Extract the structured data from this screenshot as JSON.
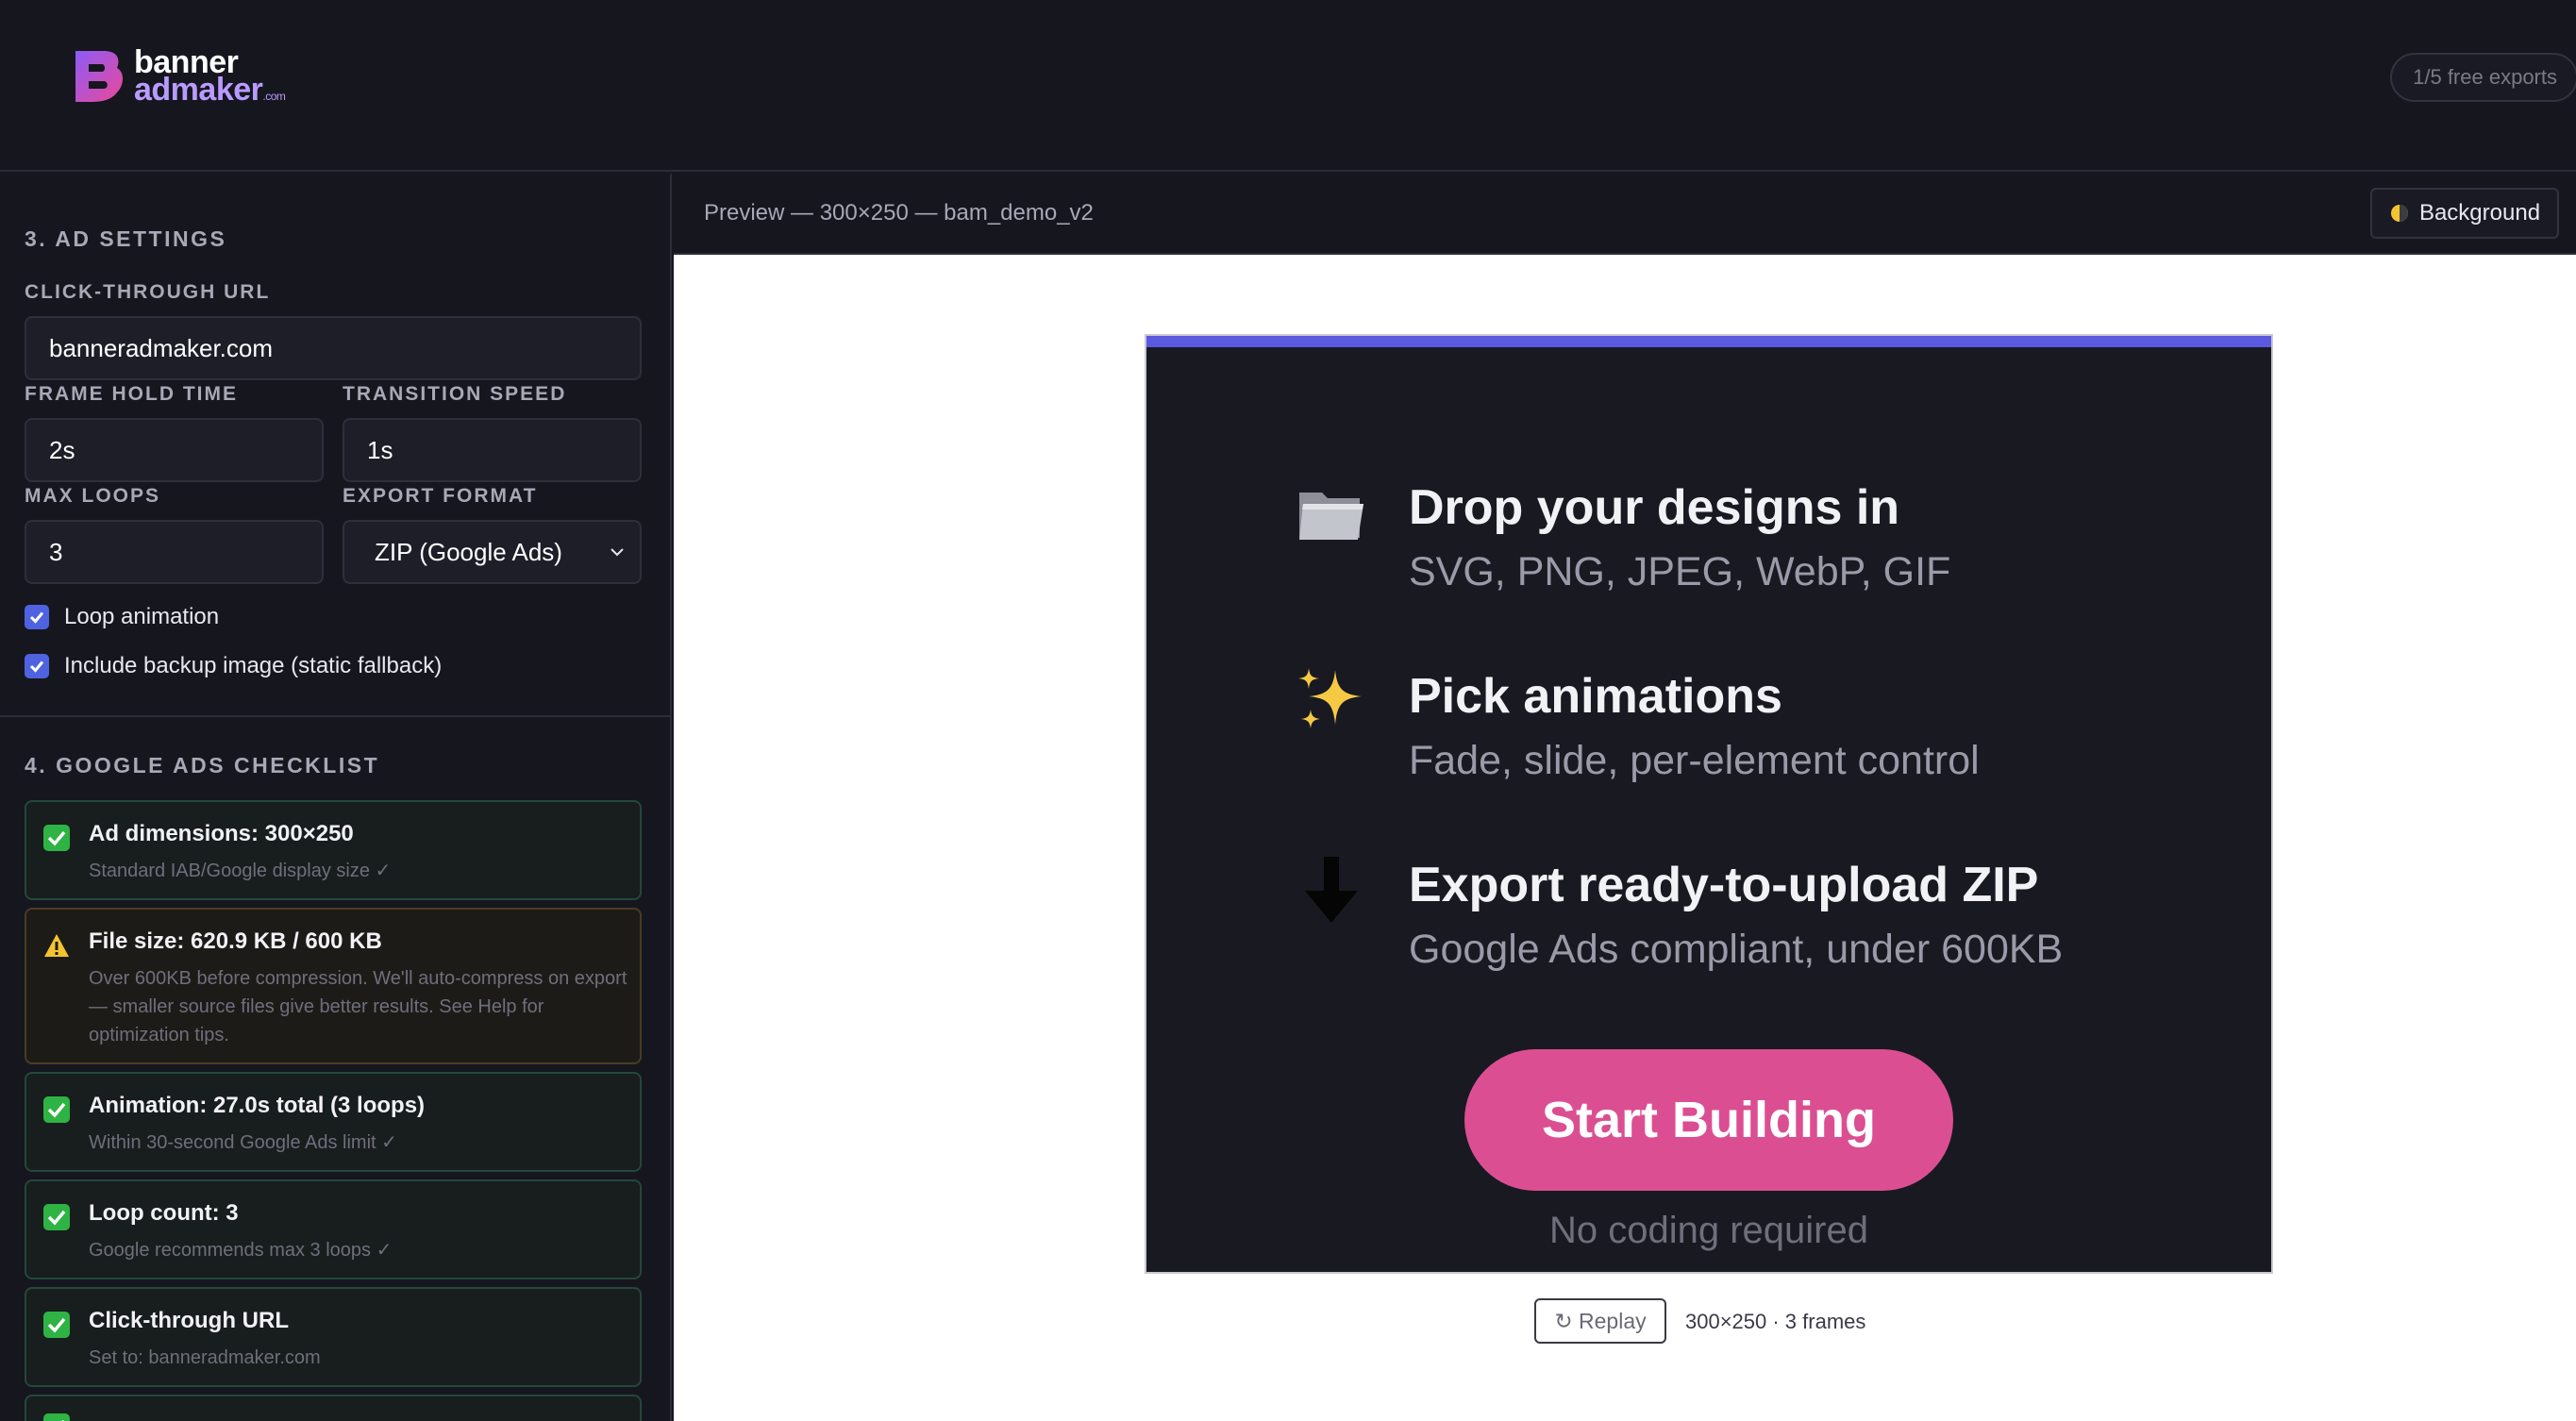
{
  "header": {
    "logo_line1": "banner",
    "logo_line2": "admaker",
    "logo_dotcom": ".com",
    "exports_label": "1/5 free exports"
  },
  "ad_settings": {
    "section_title": "3. AD SETTINGS",
    "click_url_label": "CLICK-THROUGH URL",
    "click_url_value": "banneradmaker.com",
    "frame_hold_label": "FRAME HOLD TIME",
    "frame_hold_value": "2s",
    "transition_label": "TRANSITION SPEED",
    "transition_value": "1s",
    "max_loops_label": "MAX LOOPS",
    "max_loops_value": "3",
    "export_format_label": "EXPORT FORMAT",
    "export_format_value": "ZIP (Google Ads)",
    "loop_animation_label": "Loop animation",
    "loop_animation_checked": true,
    "backup_image_label": "Include backup image (static fallback)",
    "backup_image_checked": true
  },
  "checklist": {
    "section_title": "4. GOOGLE ADS CHECKLIST",
    "items": [
      {
        "status": "pass",
        "icon": "check-icon",
        "title": "Ad dimensions: 300×250",
        "sub": "Standard IAB/Google display size ✓"
      },
      {
        "status": "warn",
        "icon": "warning-icon",
        "title": "File size: 620.9 KB / 600 KB",
        "sub": "Over 600KB before compression. We'll auto-compress on export — smaller source files give better results. See Help for optimization tips."
      },
      {
        "status": "pass",
        "icon": "check-icon",
        "title": "Animation: 27.0s total (3 loops)",
        "sub": "Within 30-second Google Ads limit ✓"
      },
      {
        "status": "pass",
        "icon": "check-icon",
        "title": "Loop count: 3",
        "sub": "Google recommends max 3 loops ✓"
      },
      {
        "status": "pass",
        "icon": "check-icon",
        "title": "Click-through URL",
        "sub": "Set to: banneradmaker.com"
      }
    ]
  },
  "preview": {
    "title": "Preview — 300×250 — bam_demo_v2",
    "background_button": "Background",
    "replay_button": "↻ Replay",
    "meta": "300×250 · 3 frames"
  },
  "ad": {
    "accent_color": "#5b59e0",
    "rows": [
      {
        "icon": "folder-icon",
        "head": "Drop your designs in",
        "sub": "SVG, PNG, JPEG, WebP, GIF"
      },
      {
        "icon": "sparkles-icon",
        "head": "Pick animations",
        "sub": "Fade, slide, per-element control"
      },
      {
        "icon": "down-arrow-icon",
        "head": "Export ready-to-upload ZIP",
        "sub": "Google Ads compliant, under 600KB"
      }
    ],
    "cta_label": "Start Building",
    "cta_color": "#db4f92",
    "cta_note": "No coding required"
  }
}
